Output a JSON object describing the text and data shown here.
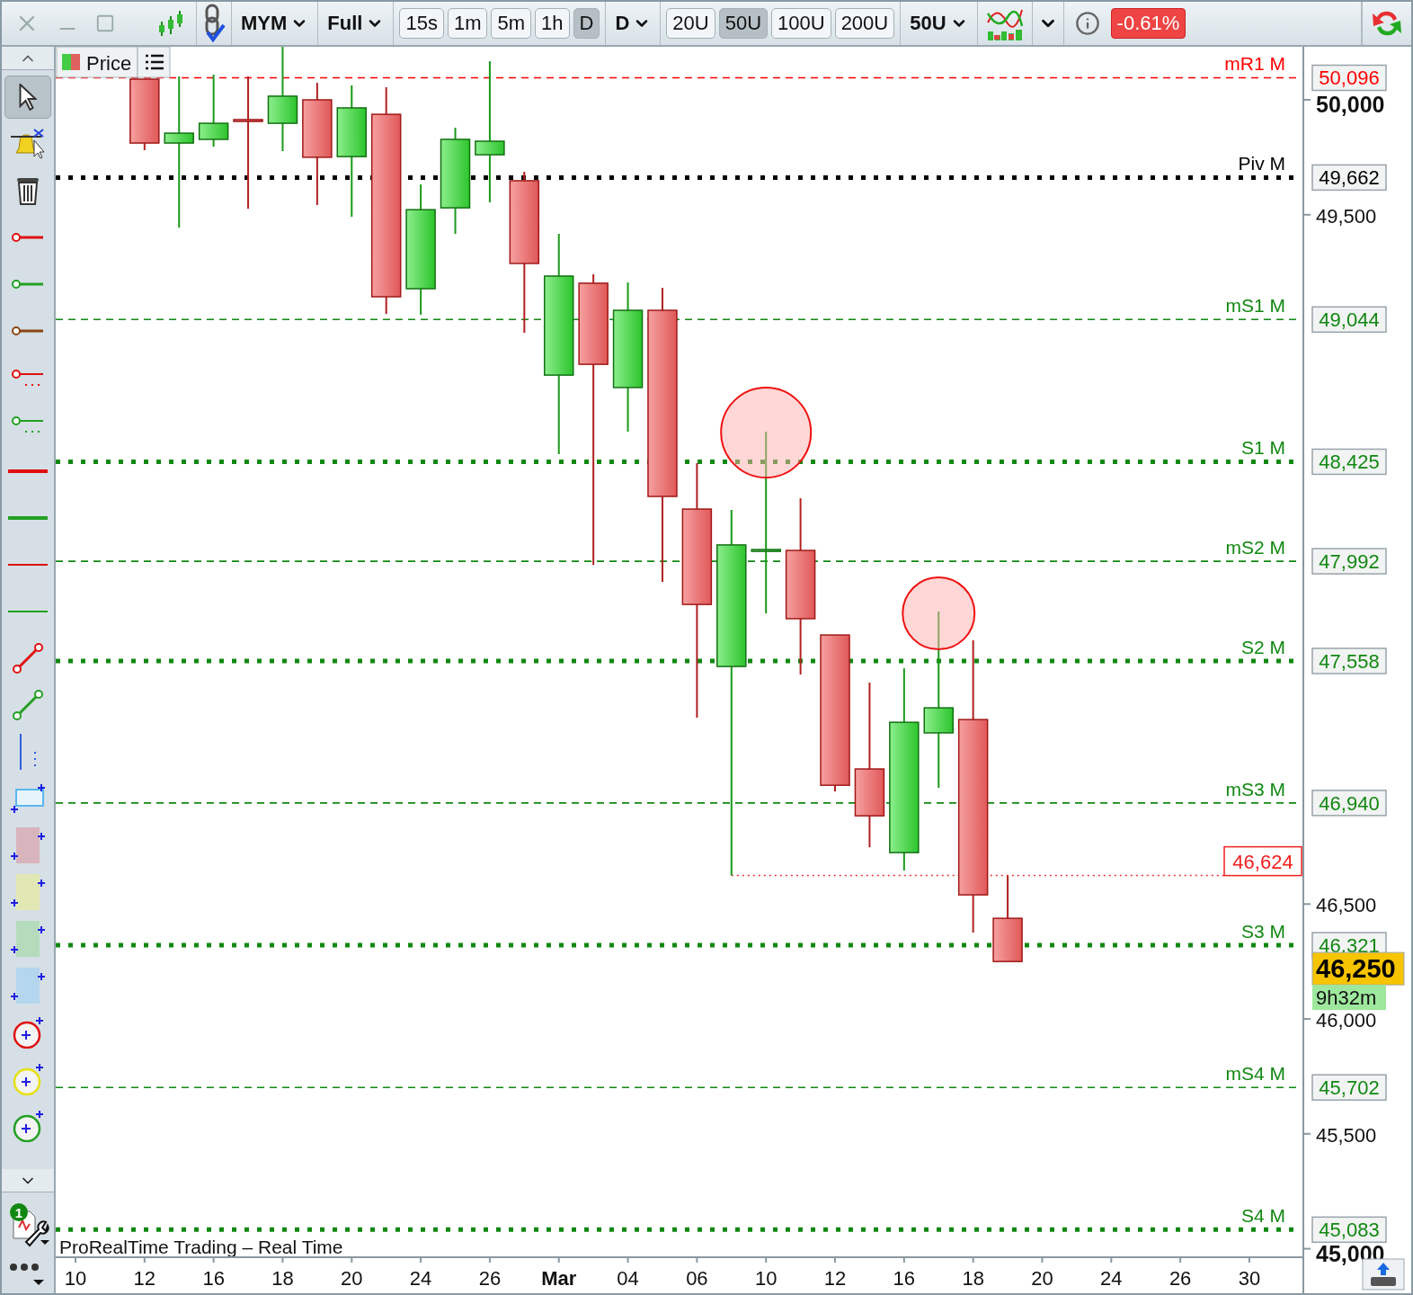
{
  "toolbar": {
    "instrument": "MYM",
    "range": "Full",
    "timeframes": [
      {
        "label": "15s",
        "selected": false
      },
      {
        "label": "1m",
        "selected": false
      },
      {
        "label": "5m",
        "selected": false
      },
      {
        "label": "1h",
        "selected": false
      },
      {
        "label": "D",
        "selected": true
      }
    ],
    "period": "D",
    "units": [
      {
        "label": "20U",
        "selected": false
      },
      {
        "label": "50U",
        "selected": true
      },
      {
        "label": "100U",
        "selected": false
      },
      {
        "label": "200U",
        "selected": false
      }
    ],
    "units_dropdown": "50U",
    "change": "-0.61%"
  },
  "tools": [
    {
      "kind": "pointer",
      "selected": true
    },
    {
      "kind": "alert",
      "selected": false
    },
    {
      "kind": "trash",
      "selected": false
    },
    {
      "kind": "ray",
      "color": "#e01010",
      "selected": false
    },
    {
      "kind": "ray",
      "color": "#22a022",
      "selected": false
    },
    {
      "kind": "ray",
      "color": "#8b4513",
      "selected": false
    },
    {
      "kind": "ray-dotted",
      "color": "#e01010",
      "selected": false
    },
    {
      "kind": "ray-dotted",
      "color": "#22a022",
      "selected": false
    },
    {
      "kind": "line-thick",
      "color": "#e01010",
      "selected": false
    },
    {
      "kind": "line-thick",
      "color": "#22a022",
      "selected": false
    },
    {
      "kind": "line",
      "color": "#e01010",
      "selected": false
    },
    {
      "kind": "line",
      "color": "#22a022",
      "selected": false
    },
    {
      "kind": "segment",
      "color": "#e01010",
      "selected": false
    },
    {
      "kind": "segment",
      "color": "#22a022",
      "selected": false
    },
    {
      "kind": "vline",
      "color": "#3060e0",
      "selected": false
    },
    {
      "kind": "rect",
      "color": "#5ab8f0",
      "selected": false
    },
    {
      "kind": "rect-fill",
      "color": "#d8b4bc",
      "selected": false
    },
    {
      "kind": "rect-fill",
      "color": "#e2e8b4",
      "selected": false
    },
    {
      "kind": "rect-fill",
      "color": "#b4dcbc",
      "selected": false
    },
    {
      "kind": "rect-fill",
      "color": "#b4d6ee",
      "selected": false
    },
    {
      "kind": "circle",
      "color": "#e01010",
      "selected": false
    },
    {
      "kind": "circle",
      "color": "#e8e010",
      "selected": false
    },
    {
      "kind": "circle",
      "color": "#22a022",
      "selected": false
    }
  ],
  "tools_badge": "1",
  "chart": {
    "legend": "Price",
    "footer": "ProRealTime Trading – Real Time",
    "levels": [
      {
        "label": "mR1 M",
        "value": "50,096",
        "kind": "dashed",
        "color": "#ff0000"
      },
      {
        "label": "Piv M",
        "value": "49,662",
        "kind": "dotted",
        "color": "#000000"
      },
      {
        "label": "mS1 M",
        "value": "49,044",
        "kind": "dashed",
        "color": "#118811"
      },
      {
        "label": "S1 M",
        "value": "48,425",
        "kind": "dotted",
        "color": "#118811"
      },
      {
        "label": "mS2 M",
        "value": "47,992",
        "kind": "dashed",
        "color": "#118811"
      },
      {
        "label": "S2 M",
        "value": "47,558",
        "kind": "dotted",
        "color": "#118811"
      },
      {
        "label": "mS3 M",
        "value": "46,940",
        "kind": "dashed",
        "color": "#118811"
      },
      {
        "label": "S3 M",
        "value": "46,321",
        "kind": "dotted",
        "color": "#118811"
      },
      {
        "label": "mS4 M",
        "value": "45,702",
        "kind": "dashed",
        "color": "#118811"
      },
      {
        "label": "S4 M",
        "value": "45,083",
        "kind": "dotted",
        "color": "#118811"
      }
    ],
    "low_marker": "46,624",
    "last_price": "46,250",
    "countdown": "9h32m",
    "price_axis": [
      {
        "label": "50,000",
        "major": true
      },
      {
        "label": "49,500",
        "major": false
      },
      {
        "label": "46,500",
        "major": false
      },
      {
        "label": "46,000",
        "major": false
      },
      {
        "label": "45,500",
        "major": false
      },
      {
        "label": "45,000",
        "major": true
      }
    ],
    "date_axis": [
      {
        "label": "10",
        "major": false
      },
      {
        "label": "12",
        "major": false
      },
      {
        "label": "16",
        "major": false
      },
      {
        "label": "18",
        "major": false
      },
      {
        "label": "20",
        "major": false
      },
      {
        "label": "24",
        "major": false
      },
      {
        "label": "26",
        "major": false
      },
      {
        "label": "Mar",
        "major": true
      },
      {
        "label": "04",
        "major": false
      },
      {
        "label": "06",
        "major": false
      },
      {
        "label": "10",
        "major": false
      },
      {
        "label": "12",
        "major": false
      },
      {
        "label": "16",
        "major": false
      },
      {
        "label": "18",
        "major": false
      },
      {
        "label": "20",
        "major": false
      },
      {
        "label": "24",
        "major": false
      },
      {
        "label": "26",
        "major": false
      },
      {
        "label": "30",
        "major": false
      }
    ]
  }
}
